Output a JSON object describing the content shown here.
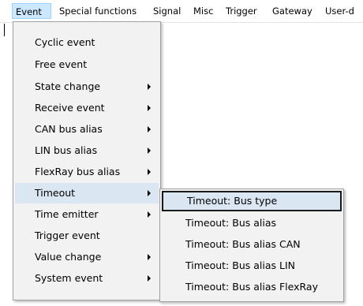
{
  "menubar": {
    "items": [
      {
        "label": "Event",
        "active": true
      },
      {
        "label": "Special functions"
      },
      {
        "label": "Signal"
      },
      {
        "label": "Misc"
      },
      {
        "label": "Trigger"
      },
      {
        "label": "Gateway"
      },
      {
        "label": "User-d"
      }
    ]
  },
  "event_menu": {
    "items": [
      {
        "label": "Cyclic event",
        "submenu": false
      },
      {
        "label": "Free event",
        "submenu": false
      },
      {
        "label": "State change",
        "submenu": true
      },
      {
        "label": "Receive event",
        "submenu": true
      },
      {
        "label": "CAN bus alias",
        "submenu": true
      },
      {
        "label": "LIN bus alias",
        "submenu": true
      },
      {
        "label": "FlexRay bus alias",
        "submenu": true
      },
      {
        "label": "Timeout",
        "submenu": true,
        "highlighted": true
      },
      {
        "label": "Time emitter",
        "submenu": true
      },
      {
        "label": "Trigger event",
        "submenu": false
      },
      {
        "label": "Value change",
        "submenu": true
      },
      {
        "label": "System event",
        "submenu": true
      }
    ]
  },
  "timeout_submenu": {
    "items": [
      {
        "label": "Timeout: Bus type",
        "focused": true
      },
      {
        "label": "Timeout: Bus alias"
      },
      {
        "label": "Timeout: Bus alias CAN"
      },
      {
        "label": "Timeout: Bus alias LIN"
      },
      {
        "label": "Timeout: Bus alias FlexRay"
      }
    ]
  },
  "colors": {
    "menu_background": "#f2f2f2",
    "highlight": "#dbe6f3",
    "active_menubar": "#cce8ff",
    "focus_border": "#1a1a1a"
  }
}
